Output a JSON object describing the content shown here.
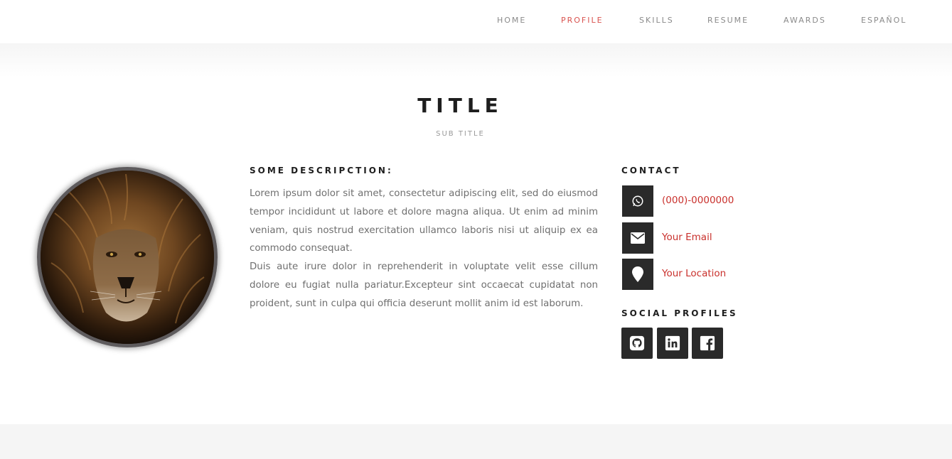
{
  "nav": {
    "items": [
      {
        "label": "HOME",
        "active": false
      },
      {
        "label": "PROFILE",
        "active": true
      },
      {
        "label": "SKILLS",
        "active": false
      },
      {
        "label": "RESUME",
        "active": false
      },
      {
        "label": "AWARDS",
        "active": false
      },
      {
        "label": "ESPAÑOL",
        "active": false
      }
    ]
  },
  "header": {
    "title": "TITLE",
    "subtitle": "SUB TITLE"
  },
  "profile": {
    "avatar_icon": "lion-photo"
  },
  "description": {
    "heading": "SOME DESCRIPCTION:",
    "paragraphs": [
      "Lorem ipsum dolor sit amet, consectetur adipiscing elit, sed do eiusmod tempor incididunt ut labore et dolore magna aliqua. Ut enim ad minim veniam, quis nostrud exercitation ullamco laboris nisi ut aliquip ex ea commodo consequat.",
      "Duis aute irure dolor in reprehenderit in voluptate velit esse cillum dolore eu fugiat nulla pariatur.Excepteur sint occaecat cupidatat non proident, sunt in culpa qui officia deserunt mollit anim id est laborum."
    ]
  },
  "contact": {
    "heading": "CONTACT",
    "items": [
      {
        "icon": "whatsapp-icon",
        "text": "(000)-0000000"
      },
      {
        "icon": "envelope-icon",
        "text": "Your Email"
      },
      {
        "icon": "map-marker-icon",
        "text": "Your Location"
      }
    ]
  },
  "social": {
    "heading": "SOCIAL PROFILES",
    "items": [
      {
        "icon": "github-icon"
      },
      {
        "icon": "linkedin-icon"
      },
      {
        "icon": "facebook-icon"
      }
    ]
  },
  "colors": {
    "accent": "#d9534f",
    "link": "#c9302c",
    "icon_bg": "#2a2a2a",
    "nav_text": "#8a8a8a"
  }
}
